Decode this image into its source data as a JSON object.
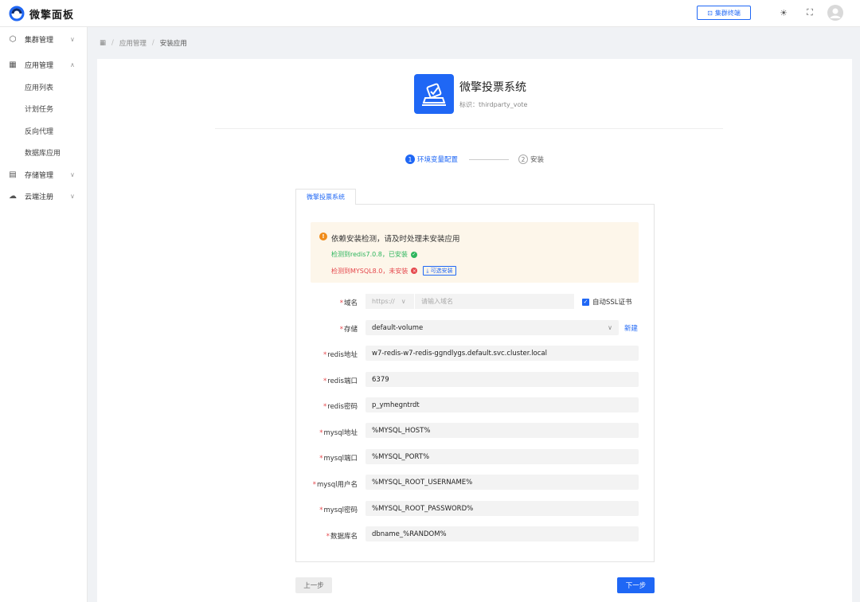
{
  "header": {
    "brand": "微擎面板",
    "cluster_terminal_label": "集群终端",
    "theme_icon": "sun-icon",
    "fullscreen_icon": "fullscreen-icon",
    "avatar_icon": "user-avatar-icon"
  },
  "sidebar": {
    "items": [
      {
        "label": "集群管理",
        "icon": "cube-icon",
        "expanded": false
      },
      {
        "label": "应用管理",
        "icon": "apps-grid-icon",
        "expanded": true
      },
      {
        "label": "存储管理",
        "icon": "storage-icon",
        "expanded": false
      },
      {
        "label": "云端注册",
        "icon": "cloud-icon",
        "expanded": false
      }
    ],
    "app_sub": [
      "应用列表",
      "计划任务",
      "反向代理",
      "数据库应用"
    ]
  },
  "breadcrumb": {
    "home_icon": "grid-home-icon",
    "parent": "应用管理",
    "current": "安装应用",
    "sep": "/"
  },
  "app": {
    "name": "微擎投票系统",
    "id_label": "标识：thirdparty_vote"
  },
  "steps": [
    {
      "num": "1",
      "label": "环境变量配置",
      "active": true
    },
    {
      "num": "2",
      "label": "安装",
      "active": false
    }
  ],
  "tab_label": "微擎投票系统",
  "alert": {
    "title": "依赖安装检测，请及时处理未安装应用",
    "ok_text": "检测到redis7.0.8，已安装",
    "bad_text": "检测到MYSQL8.0，未安装",
    "optional_install": "可选安装",
    "colors": {
      "ok": "#2db55d",
      "bad": "#e5484d",
      "warn": "#f08c1a"
    }
  },
  "form": {
    "domain": {
      "label": "域名",
      "prefix": "https://",
      "placeholder": "请输入域名",
      "ssl_label": "自动SSL证书",
      "ssl_checked": true
    },
    "storage": {
      "label": "存储",
      "value": "default-volume",
      "new_label": "新建"
    },
    "fields": [
      {
        "label": "redis地址",
        "value": "w7-redis-w7-redis-ggndlygs.default.svc.cluster.local"
      },
      {
        "label": "redis端口",
        "value": "6379"
      },
      {
        "label": "redis密码",
        "value": "p_ymhegntrdt"
      },
      {
        "label": "mysql地址",
        "value": "%MYSQL_HOST%"
      },
      {
        "label": "mysql端口",
        "value": "%MYSQL_PORT%"
      },
      {
        "label": "mysql用户名",
        "value": "%MYSQL_ROOT_USERNAME%"
      },
      {
        "label": "mysql密码",
        "value": "%MYSQL_ROOT_PASSWORD%"
      },
      {
        "label": "数据库名",
        "value": "dbname_%RANDOM%"
      }
    ]
  },
  "buttons": {
    "prev": "上一步",
    "next": "下一步"
  },
  "accent": "#1f67f5"
}
